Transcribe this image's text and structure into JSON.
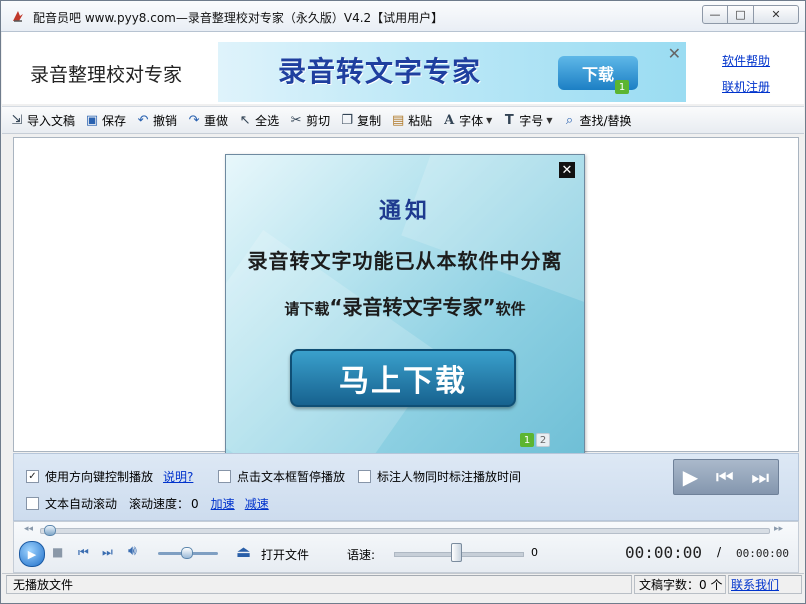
{
  "window": {
    "title": "配音员吧 www.pyy8.com—录音整理校对专家（永久版）V4.2【试用用户】",
    "min_symbol": "—",
    "max_symbol": "□",
    "close_symbol": "✕"
  },
  "header": {
    "app_name": "录音整理校对专家",
    "banner_title": "录音转文字专家",
    "banner_button": "下载",
    "banner_badge": "1",
    "banner_close": "✕",
    "help_link": "软件帮助",
    "register_link": "联机注册"
  },
  "toolbar": {
    "items": [
      {
        "label": "导入文稿",
        "icon": "import-icon"
      },
      {
        "label": "保存",
        "icon": "save-icon"
      },
      {
        "label": "撤销",
        "icon": "undo-icon"
      },
      {
        "label": "重做",
        "icon": "redo-icon"
      },
      {
        "label": "全选",
        "icon": "select-all-icon"
      },
      {
        "label": "剪切",
        "icon": "cut-icon"
      },
      {
        "label": "复制",
        "icon": "copy-icon"
      },
      {
        "label": "粘贴",
        "icon": "paste-icon"
      },
      {
        "label": "字体",
        "icon": "font-icon"
      },
      {
        "label": "字号",
        "icon": "font-size-icon"
      },
      {
        "label": "查找/替换",
        "icon": "search-icon"
      }
    ]
  },
  "notice": {
    "title": "通知",
    "line1": "录音转文字功能已从本软件中分离",
    "line2_prefix": "请下载",
    "line2_product": "“录音转文字专家”",
    "line2_suffix": "软件",
    "button": "马上下载",
    "close_symbol": "✕",
    "pages": [
      "1",
      "2"
    ]
  },
  "options": {
    "arrow_keys_label": "使用方向键控制播放",
    "arrow_keys_checked": true,
    "explain_link": "说明?",
    "click_pause_label": "点击文本框暂停播放",
    "click_pause_checked": false,
    "mark_time_label": "标注人物同时标注播放时间",
    "mark_time_checked": false,
    "auto_scroll_label": "文本自动滚动",
    "auto_scroll_checked": false,
    "scroll_speed_label": "滚动速度：",
    "scroll_speed_value": "0",
    "faster_link": "加速",
    "slower_link": "减速"
  },
  "transport": {
    "open_file": "打开文件",
    "speech_speed_label": "语速:",
    "speech_speed_value": "0",
    "current_time": "00:00:00",
    "separator": "/",
    "total_time": "00:00:00",
    "progress_fraction": 0.0,
    "volume_fraction": 0.45
  },
  "status": {
    "file": "无播放文件",
    "word_count": "文稿字数：0 个",
    "contact": "联系我们"
  },
  "colors": {
    "link": "#0033cc",
    "notice_title": "#1e3a8f",
    "notice_button": "#17628f",
    "badge_green": "#5cb531"
  }
}
